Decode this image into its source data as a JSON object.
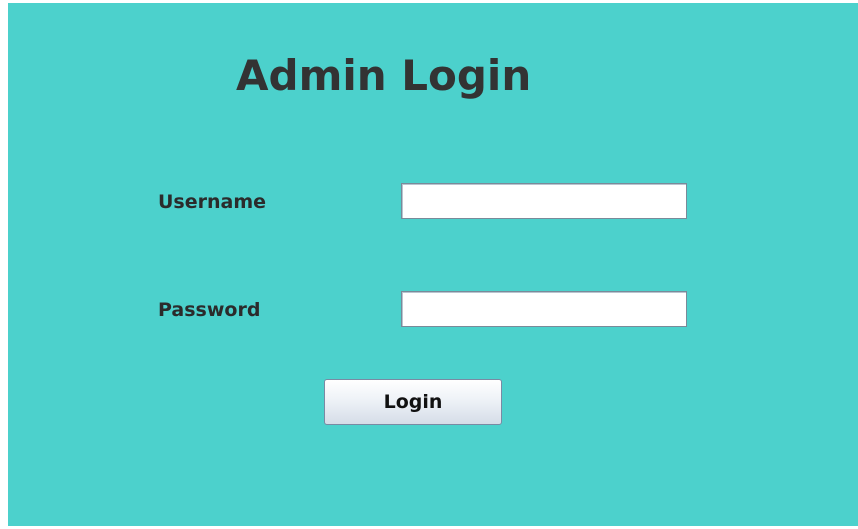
{
  "window": {
    "background_color": "#4cd1cc"
  },
  "title": "Admin Login",
  "form": {
    "username_label": "Username",
    "username_value": "",
    "password_label": "Password",
    "password_value": "",
    "login_label": "Login"
  }
}
